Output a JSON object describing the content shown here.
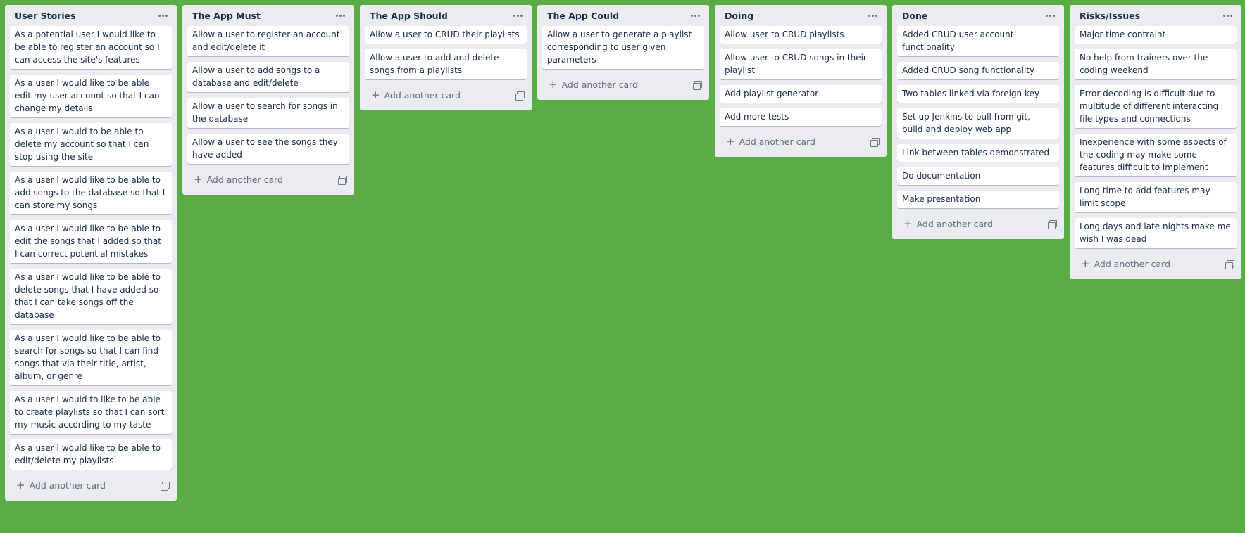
{
  "lists": [
    {
      "title": "User Stories",
      "cards": [
        "As a potential user I would like to be able to register an account so I can access the site's features",
        "As a user I would like to be able edit my user account so that I can change my details",
        "As a user I would to be able to delete my account so that I can stop using the site",
        "As a user I would like to be able to add songs to the database so that I can store my songs",
        "As a user I would like to be able to edit the songs that I added so that I can correct potential mistakes",
        "As a user I would like to be able to delete songs that I have added so that I can take songs off the database",
        "As a user I would like to be able to search for songs so that I can find songs that via their title, artist, album, or genre",
        "As a user I would to like to be able to create playlists so that I can sort my music according to my taste",
        "As a user I would like to be able to edit/delete my playlists"
      ],
      "add_label": "Add another card"
    },
    {
      "title": "The App Must",
      "cards": [
        "Allow a user to register an account and edit/delete it",
        "Allow a user to add songs to a database and edit/delete",
        "Allow a user to search for songs in the database",
        "Allow a user to see the songs they have added"
      ],
      "add_label": "Add another card"
    },
    {
      "title": "The App Should",
      "cards": [
        "Allow a user to CRUD their playlists",
        "Allow a user to add and delete songs from a playlists"
      ],
      "add_label": "Add another card"
    },
    {
      "title": "The App Could",
      "cards": [
        "Allow a user to generate a playlist corresponding to user given parameters"
      ],
      "add_label": "Add another card"
    },
    {
      "title": "Doing",
      "cards": [
        "Allow user to CRUD playlists",
        "Allow user to CRUD songs in their playlist",
        "Add playlist generator",
        "Add more tests"
      ],
      "add_label": "Add another card"
    },
    {
      "title": "Done",
      "cards": [
        "Added CRUD user account functionality",
        "Added CRUD song functionality",
        "Two tables linked via foreign key",
        "Set up Jenkins to pull from git, build and deploy web app",
        "Link between tables demonstrated",
        "Do documentation",
        "Make presentation"
      ],
      "add_label": "Add another card"
    },
    {
      "title": "Risks/Issues",
      "cards": [
        "Major time contraint",
        "No help from trainers over the coding weekend",
        "Error decoding is difficult due to multitude of different interacting file types and connections",
        "Inexperience with some aspects of the coding may make some features difficult to implement",
        "Long time to add features may limit scope",
        "Long days and late nights make me wish I was dead"
      ],
      "add_label": "Add another card"
    }
  ],
  "colors": {
    "board_background": "#5aac44",
    "list_background": "#ebecf0",
    "card_background": "#ffffff"
  }
}
